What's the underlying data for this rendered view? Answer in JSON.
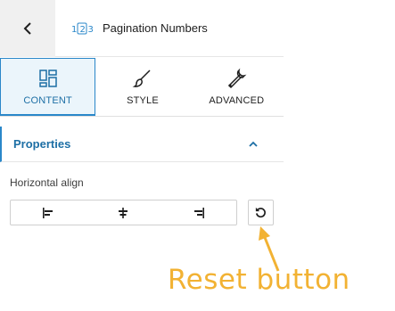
{
  "header": {
    "back_icon": "chevron-left-icon",
    "block_icon": "pagination-icon",
    "block_icon_text": "1 2 3",
    "title": "Pagination Numbers"
  },
  "tabs": [
    {
      "label": "CONTENT",
      "icon": "layout-icon",
      "active": true
    },
    {
      "label": "STYLE",
      "icon": "brush-icon",
      "active": false
    },
    {
      "label": "ADVANCED",
      "icon": "wrench-icon",
      "active": false
    }
  ],
  "panel": {
    "title": "Properties",
    "expanded": true,
    "field": {
      "label": "Horizontal align",
      "options": [
        {
          "name": "align-left",
          "icon": "align-left-icon",
          "selected": false
        },
        {
          "name": "align-center",
          "icon": "align-center-icon",
          "selected": false
        },
        {
          "name": "align-right",
          "icon": "align-right-icon",
          "selected": false
        }
      ],
      "reset_icon": "reset-icon"
    }
  },
  "annotation": {
    "text": "Reset button",
    "color": "#f2b233"
  },
  "colors": {
    "accent": "#2a87c9",
    "accent_text": "#1d6fa5",
    "active_tab_bg": "#ebf5fb"
  }
}
